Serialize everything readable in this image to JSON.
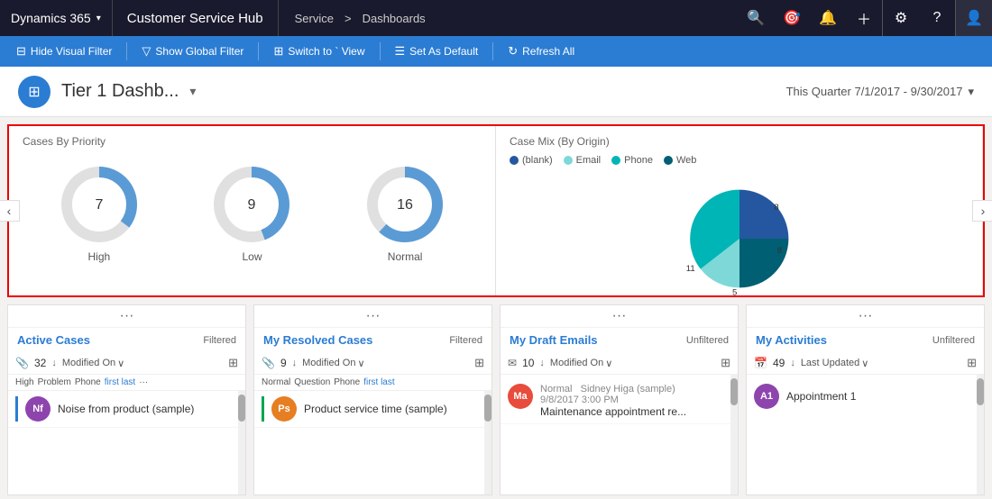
{
  "topNav": {
    "dynamics365": "Dynamics 365",
    "appName": "Customer Service Hub",
    "breadcrumb": [
      "Service",
      "Dashboards"
    ],
    "breadcrumbSeparator": ">"
  },
  "toolbar": {
    "hideVisualFilter": "Hide Visual Filter",
    "showGlobalFilter": "Show Global Filter",
    "switchToTileView": "Switch to ` View",
    "setAsDefault": "Set As Default",
    "refreshAll": "Refresh All"
  },
  "pageHeader": {
    "title": "Tier 1 Dashb...",
    "dateRange": "This Quarter 7/1/2017 - 9/30/2017"
  },
  "chartsPanelLeft": {
    "title": "Cases By Priority",
    "charts": [
      {
        "label": "High",
        "value": "7"
      },
      {
        "label": "Low",
        "value": "9"
      },
      {
        "label": "Normal",
        "value": "16"
      }
    ]
  },
  "chartsPanelRight": {
    "title": "Case Mix (By Origin)",
    "legend": [
      {
        "label": "(blank)",
        "color": "#2457a0"
      },
      {
        "label": "Email",
        "color": "#7ed8d8"
      },
      {
        "label": "Phone",
        "color": "#00b5b5"
      },
      {
        "label": "Web",
        "color": "#005f73"
      }
    ],
    "pieData": [
      {
        "label": "8",
        "value": 8,
        "color": "#2457a0"
      },
      {
        "label": "8",
        "value": 8,
        "color": "#005f73"
      },
      {
        "label": "5",
        "value": 5,
        "color": "#7ed8d8"
      },
      {
        "label": "11",
        "value": 11,
        "color": "#00b5b5"
      }
    ]
  },
  "cards": [
    {
      "id": "active-cases",
      "title": "Active Cases",
      "filter": "Filtered",
      "count": "32",
      "sortLabel": "Modified On",
      "tags": [
        "High",
        "Problem",
        "Phone",
        "first last",
        "···"
      ],
      "items": [
        {
          "initials": "Nf",
          "text": "Noise from product (sample)",
          "color": "#8e44ad"
        }
      ]
    },
    {
      "id": "my-resolved-cases",
      "title": "My Resolved Cases",
      "filter": "Filtered",
      "count": "9",
      "sortLabel": "Modified On",
      "tags": [
        "Normal",
        "Question",
        "Phone",
        "first last"
      ],
      "items": [
        {
          "initials": "Ps",
          "text": "Product service time (sample)",
          "color": "#e67e22",
          "hasAccent": true
        }
      ]
    },
    {
      "id": "my-draft-emails",
      "title": "My Draft Emails",
      "filter": "Unfiltered",
      "count": "10",
      "sortLabel": "Modified On",
      "tags": [],
      "items": [
        {
          "initials": "Ma",
          "text": "Maintenance appointment re...",
          "subtext": "Normal  Sidney Higa (sample)\n9/8/2017 3:00 PM",
          "color": "#e74c3c"
        }
      ]
    },
    {
      "id": "my-activities",
      "title": "My Activities",
      "filter": "Unfiltered",
      "count": "49",
      "sortLabel": "Last Updated",
      "tags": [],
      "items": [
        {
          "initials": "A1",
          "text": "Appointment 1",
          "color": "#8e44ad"
        }
      ]
    }
  ]
}
